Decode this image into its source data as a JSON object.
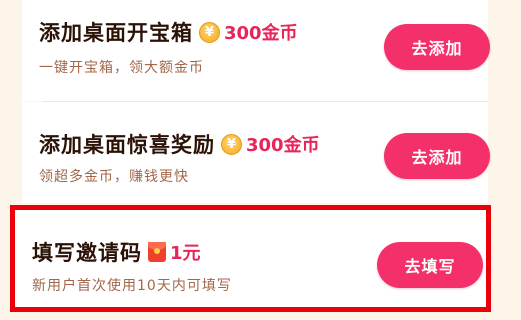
{
  "tasks": [
    {
      "title": "添加桌面开宝箱",
      "reward_icon": "gold-coin-icon",
      "coin_symbol": "¥",
      "reward": "300金币",
      "subtitle": "一键开宝箱，领大额金币",
      "button": "去添加"
    },
    {
      "title": "添加桌面惊喜奖励",
      "reward_icon": "gold-coin-icon",
      "coin_symbol": "¥",
      "reward": "300金币",
      "subtitle": "领超多金币，赚钱更快",
      "button": "去添加"
    },
    {
      "title": "填写邀请码",
      "reward_icon": "red-packet-icon",
      "reward": "1元",
      "subtitle": "新用户首次使用10天内可填写",
      "button": "去填写",
      "highlighted": true
    }
  ],
  "colors": {
    "button": "#f4306a",
    "reward_text": "#e8245a",
    "highlight_border": "#e8000b",
    "background": "#fdf4ea"
  }
}
